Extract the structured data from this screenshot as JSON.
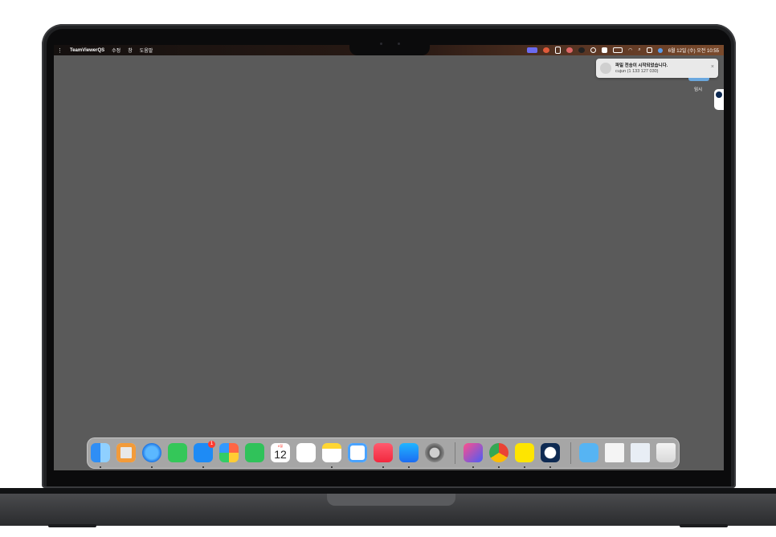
{
  "menubar": {
    "apple": "",
    "app_name": "TeamViewerQS",
    "menu_edit": "수정",
    "menu_window": "창",
    "menu_help": "도움말",
    "clock": "6월 12일 (수) 오전 10:55"
  },
  "notification": {
    "title": "파일 전송이 시작되었습니다.",
    "subtitle": "cujun (1 133 127 030)",
    "close": "×"
  },
  "sidebar": {
    "temp_label": "임시"
  },
  "dock": {
    "mail_badge": "1",
    "calendar_month": "6월",
    "calendar_day": "12",
    "items": [
      "Finder",
      "Launchpad",
      "Safari",
      "Messages",
      "Mail",
      "Photos",
      "FaceTime",
      "Calendar",
      "Reminders",
      "Notes",
      "Freeform",
      "Music",
      "App Store",
      "System Settings",
      "Shortcuts",
      "Chrome",
      "KakaoTalk",
      "TeamViewer",
      "Downloads",
      "Document 1",
      "Document 2",
      "Trash"
    ]
  },
  "colors": {
    "desktop": "#5a5a5a",
    "accent_blue": "#6aa8df"
  }
}
